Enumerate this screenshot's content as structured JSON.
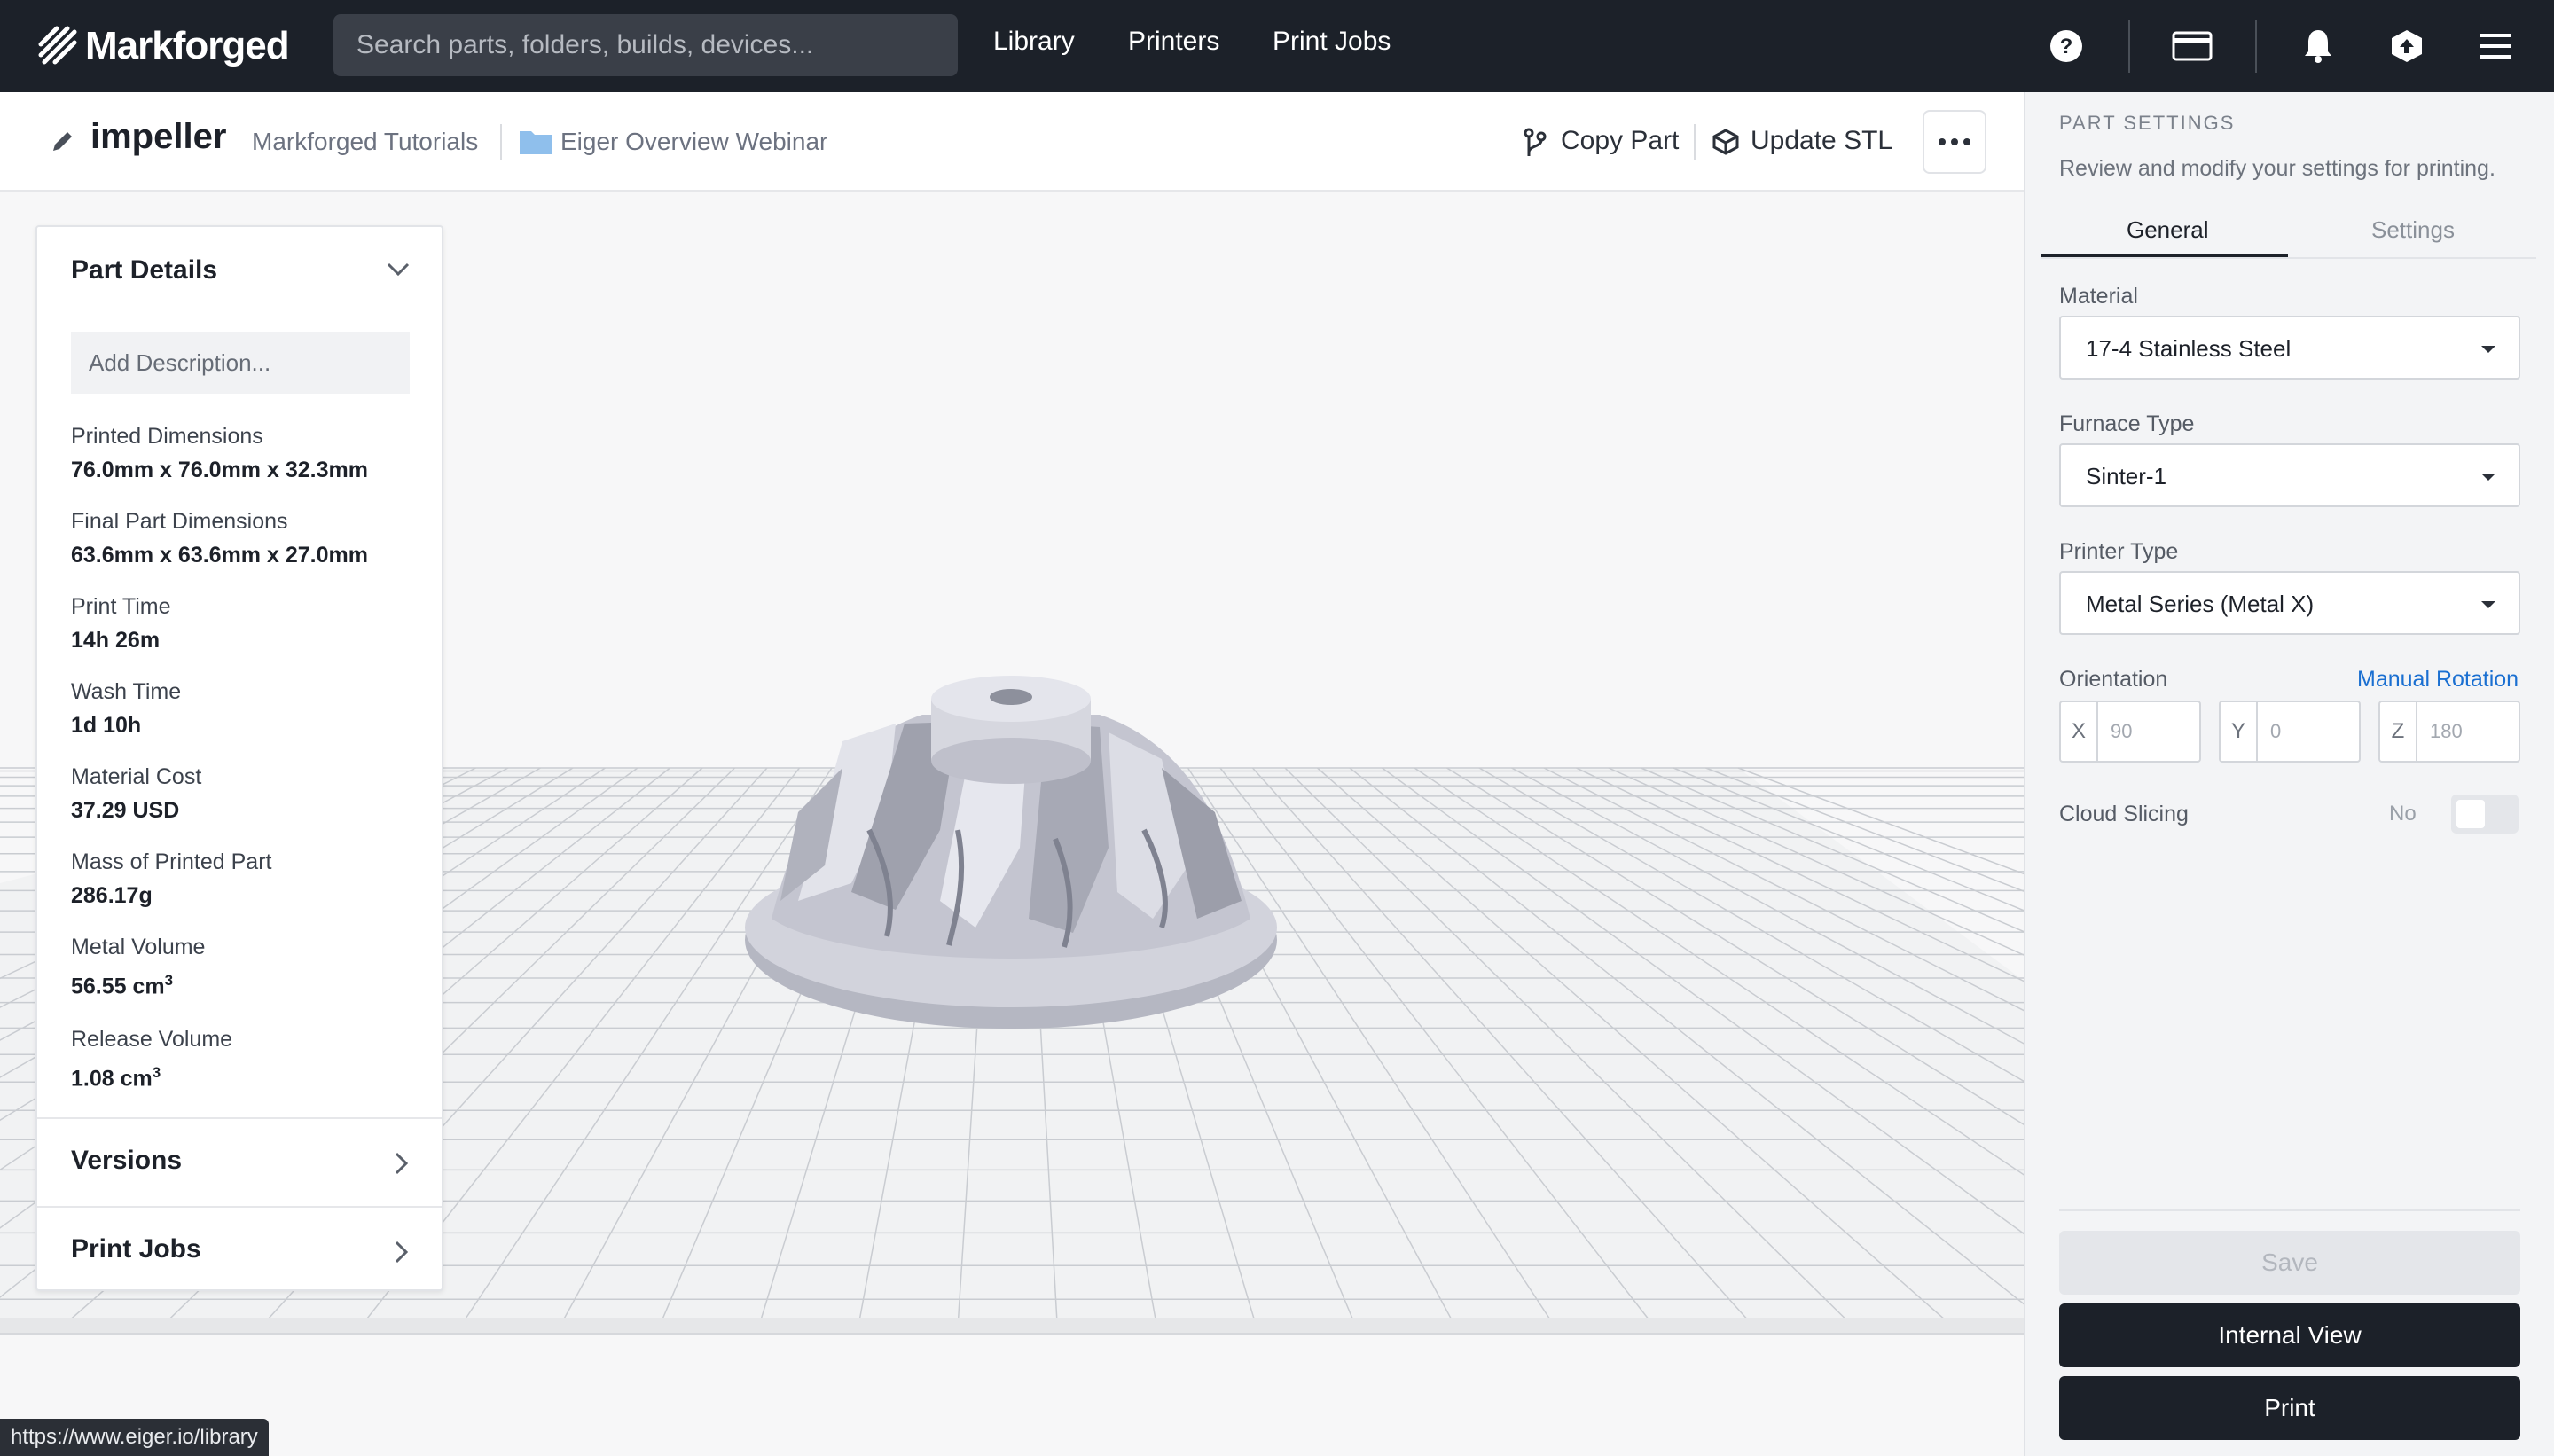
{
  "topbar": {
    "logo_text": "Markforged",
    "search_placeholder": "Search parts, folders, builds, devices...",
    "nav": [
      "Library",
      "Printers",
      "Print Jobs"
    ],
    "icons": [
      "help-icon",
      "card-icon",
      "bell-icon",
      "upload-icon",
      "menu-icon"
    ]
  },
  "header": {
    "part_name": "impeller",
    "workspace": "Markforged Tutorials",
    "folder": "Eiger Overview Webinar",
    "copy_part": "Copy Part",
    "update_stl": "Update STL"
  },
  "details": {
    "title": "Part Details",
    "description_placeholder": "Add Description...",
    "stats": [
      {
        "label": "Printed Dimensions",
        "value": "76.0mm x 76.0mm x 32.3mm"
      },
      {
        "label": "Final Part Dimensions",
        "value": "63.6mm x 63.6mm x 27.0mm"
      },
      {
        "label": "Print Time",
        "value": "14h 26m"
      },
      {
        "label": "Wash Time",
        "value": "1d 10h"
      },
      {
        "label": "Material Cost",
        "value": "37.29 USD"
      },
      {
        "label": "Mass of Printed Part",
        "value": "286.17g"
      },
      {
        "label": "Metal Volume",
        "value": "56.55 cm",
        "sup": "3"
      },
      {
        "label": "Release Volume",
        "value": "1.08 cm",
        "sup": "3"
      }
    ],
    "versions": "Versions",
    "print_jobs": "Print Jobs"
  },
  "panel": {
    "title": "PART SETTINGS",
    "subtitle": "Review and modify your settings for printing.",
    "tabs": [
      "General",
      "Settings"
    ],
    "material_label": "Material",
    "material_value": "17-4 Stainless Steel",
    "furnace_label": "Furnace Type",
    "furnace_value": "Sinter-1",
    "printer_label": "Printer Type",
    "printer_value": "Metal Series (Metal X)",
    "orientation_label": "Orientation",
    "manual_rotation": "Manual Rotation",
    "orientation": [
      {
        "axis": "X",
        "value": "90"
      },
      {
        "axis": "Y",
        "value": "0"
      },
      {
        "axis": "Z",
        "value": "180"
      }
    ],
    "cloud_slicing_label": "Cloud Slicing",
    "cloud_slicing_value": "No",
    "save": "Save",
    "internal_view": "Internal View",
    "print": "Print"
  },
  "status_url": "https://www.eiger.io/library",
  "colors": {
    "topbar": "#1c2129",
    "accent_link": "#1a6fd1",
    "folder": "#8fbfec"
  }
}
